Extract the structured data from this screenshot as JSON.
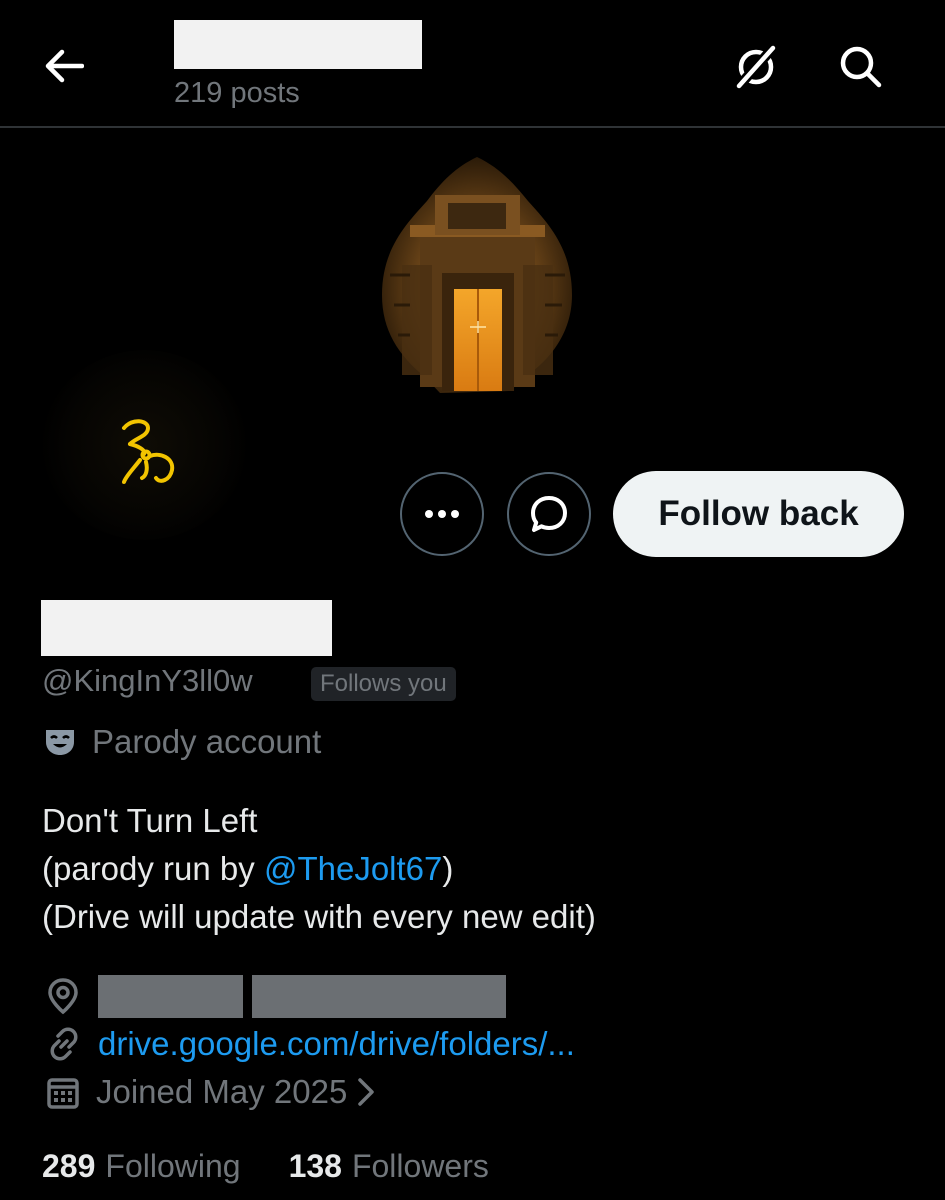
{
  "header": {
    "post_count": "219 posts",
    "icons": [
      "back-arrow-icon",
      "grok-icon",
      "search-icon"
    ]
  },
  "actions": {
    "follow_back_label": "Follow back",
    "icons": [
      "more-icon",
      "message-icon"
    ]
  },
  "profile": {
    "handle": "@KingInY3ll0w",
    "follows_you": "Follows you",
    "parody_label": "Parody account",
    "bio": {
      "line1": "Don't Turn Left",
      "line2_prefix": "(parody run by ",
      "line2_mention": "@TheJolt67",
      "line2_suffix": ")",
      "line3": "(Drive will update with every new edit)"
    },
    "link": "drive.google.com/drive/folders/...",
    "joined": "Joined May 2025"
  },
  "stats": {
    "following_count": "289",
    "following_label": "Following",
    "followers_count": "138",
    "followers_label": "Followers"
  },
  "colors": {
    "background": "#000000",
    "text": "#e7e9ea",
    "secondary_text": "#71767b",
    "link": "#1d9bf0",
    "button_bg": "#eff3f4",
    "avatar_glyph": "#f2c400"
  }
}
